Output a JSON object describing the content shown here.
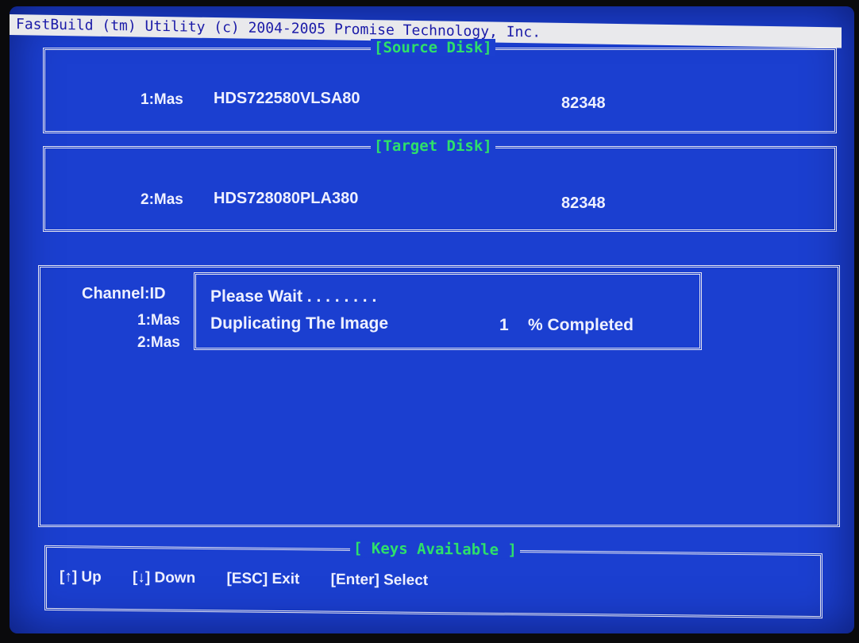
{
  "title_bar": "FastBuild (tm) Utility (c) 2004-2005 Promise Technology, Inc.",
  "source_panel": {
    "title": "[Source Disk]",
    "row": {
      "id": "1:Mas",
      "model": "HDS722580VLSA80",
      "size": "82348"
    }
  },
  "target_panel": {
    "title": "[Target Disk]",
    "row": {
      "id": "2:Mas",
      "model": "HDS728080PLA380",
      "size": "82348"
    }
  },
  "channel_panel": {
    "header": "Channel:ID",
    "rows": [
      "1:Mas",
      "2:Mas"
    ]
  },
  "dialog": {
    "line1": "Please Wait . . . . . . . .",
    "line2_label": "Duplicating The Image",
    "percent": "1",
    "line2_suffix": "% Completed"
  },
  "keys_panel": {
    "title": "[ Keys Available ]",
    "keys": [
      "[↑] Up",
      "[↓] Down",
      "[ESC] Exit",
      "[Enter] Select"
    ]
  },
  "colors": {
    "screen_bg": "#1b3fd0",
    "title_bar_bg": "#e9e9ec",
    "title_text": "#1a1aa8",
    "panel_title": "#2ee06a",
    "text": "#eef0ff"
  }
}
